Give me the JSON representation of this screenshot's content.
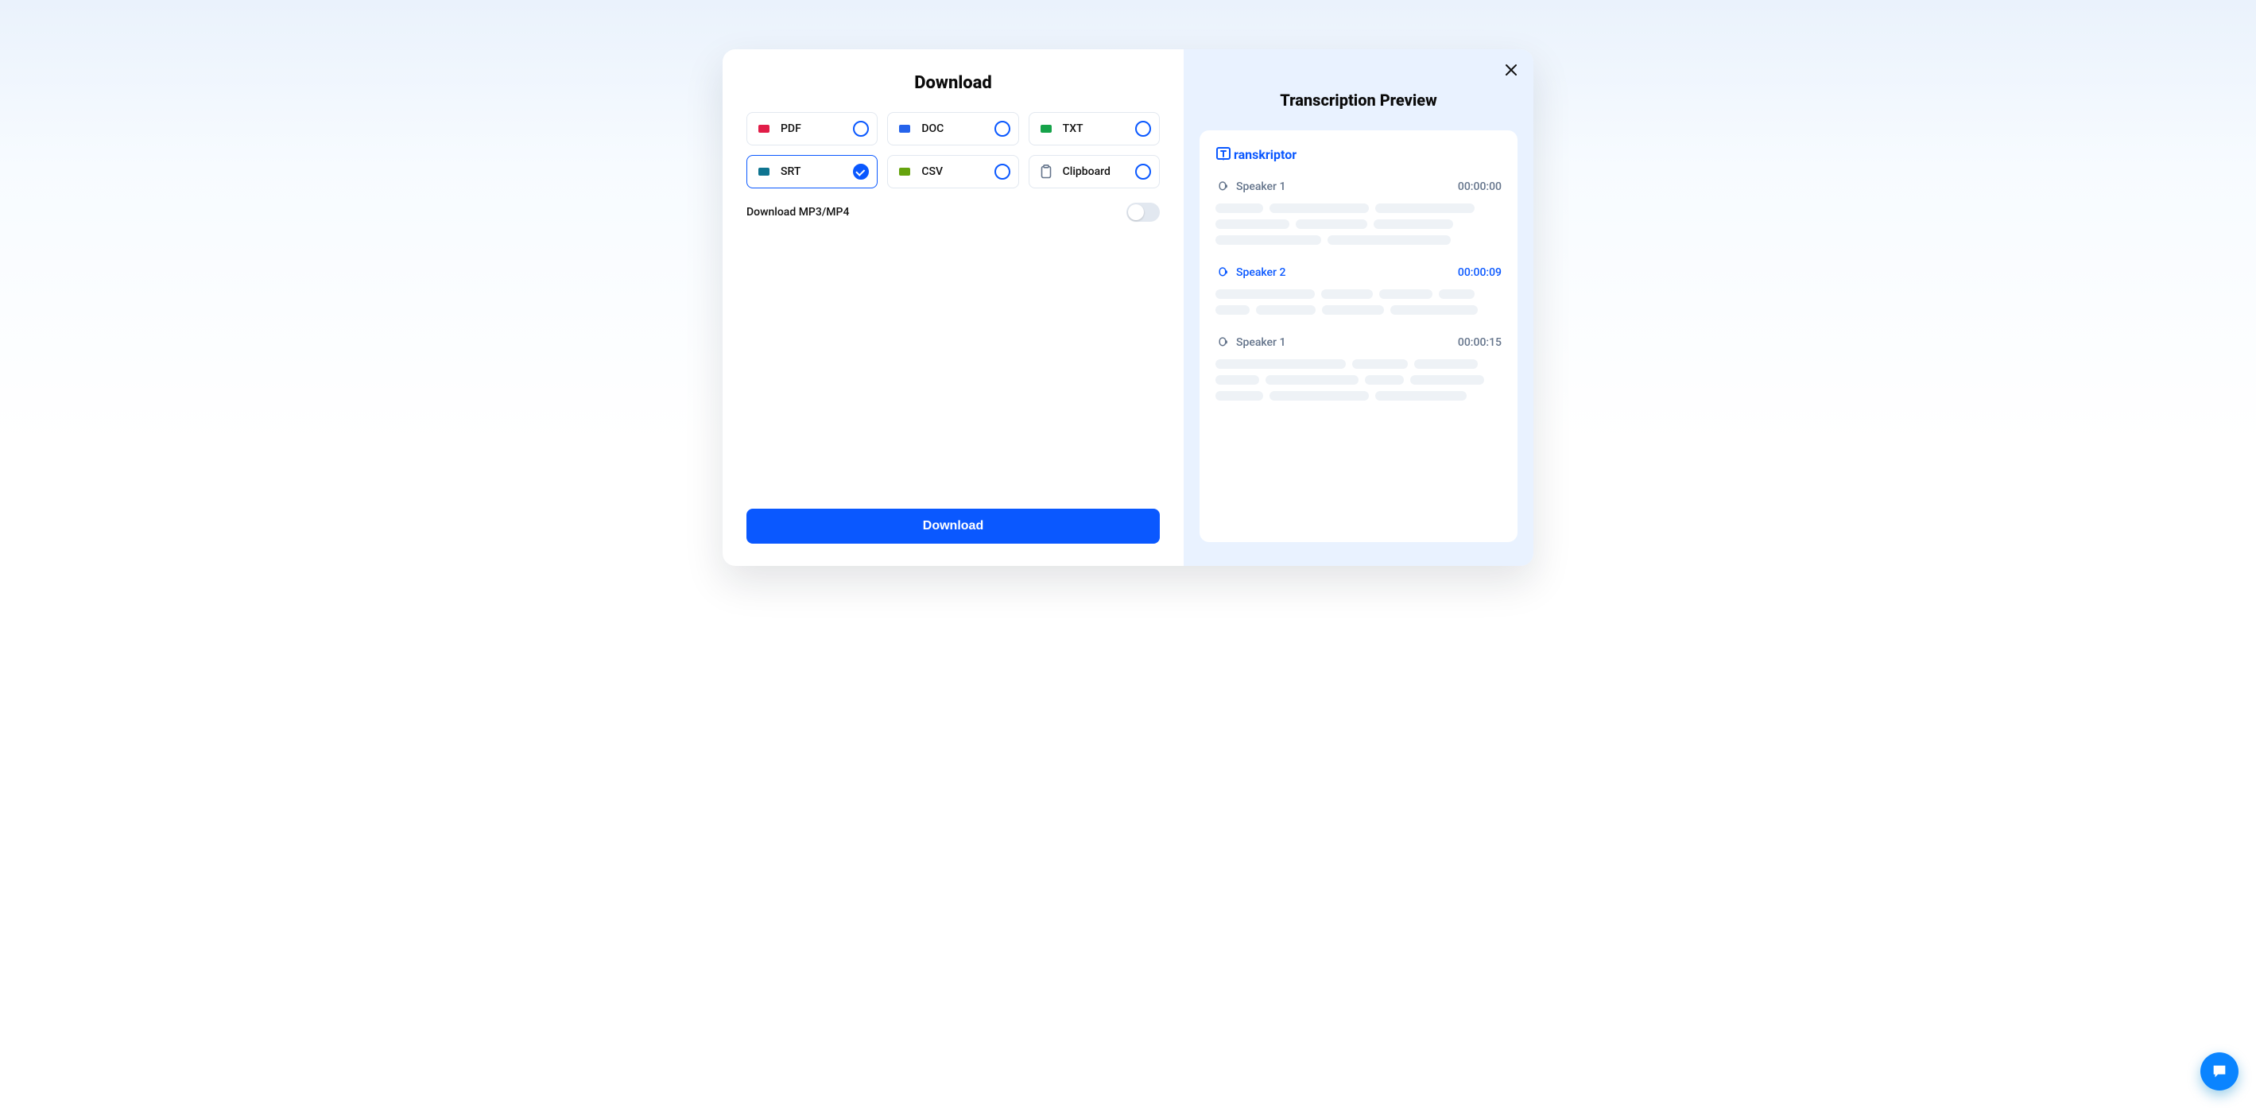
{
  "download": {
    "title": "Download",
    "formats": [
      {
        "key": "pdf",
        "label": "PDF",
        "selected": false,
        "badgeColor": "#e11d48"
      },
      {
        "key": "doc",
        "label": "DOC",
        "selected": false,
        "badgeColor": "#2563eb"
      },
      {
        "key": "txt",
        "label": "TXT",
        "selected": false,
        "badgeColor": "#16a34a"
      },
      {
        "key": "srt",
        "label": "SRT",
        "selected": true,
        "badgeColor": "#0e7490"
      },
      {
        "key": "csv",
        "label": "CSV",
        "selected": false,
        "badgeColor": "#65a30d"
      },
      {
        "key": "clipboard",
        "label": "Clipboard",
        "selected": false,
        "badgeColor": null
      }
    ],
    "mp3_label": "Download MP3/MP4",
    "mp3_enabled": false,
    "button_label": "Download"
  },
  "preview": {
    "title": "Transcription Preview",
    "brand": "ranskriptor",
    "segments": [
      {
        "speaker": "Speaker 1",
        "time": "00:00:00",
        "blue": false,
        "rows": [
          [
            60,
            125,
            125
          ],
          [
            93,
            90,
            100
          ],
          [
            133,
            155
          ]
        ]
      },
      {
        "speaker": "Speaker 2",
        "time": "00:00:09",
        "blue": true,
        "rows": [
          [
            125,
            65,
            67,
            45
          ],
          [
            43,
            75,
            78,
            110
          ]
        ]
      },
      {
        "speaker": "Speaker 1",
        "time": "00:00:15",
        "blue": false,
        "rows": [
          [
            164,
            70,
            80
          ],
          [
            55,
            117,
            49,
            93
          ],
          [
            60,
            125,
            115
          ]
        ]
      }
    ]
  },
  "icons": {
    "close": "close-icon",
    "chat": "chat-icon",
    "speaker": "speaker-icon",
    "clipboard": "clipboard-icon"
  }
}
